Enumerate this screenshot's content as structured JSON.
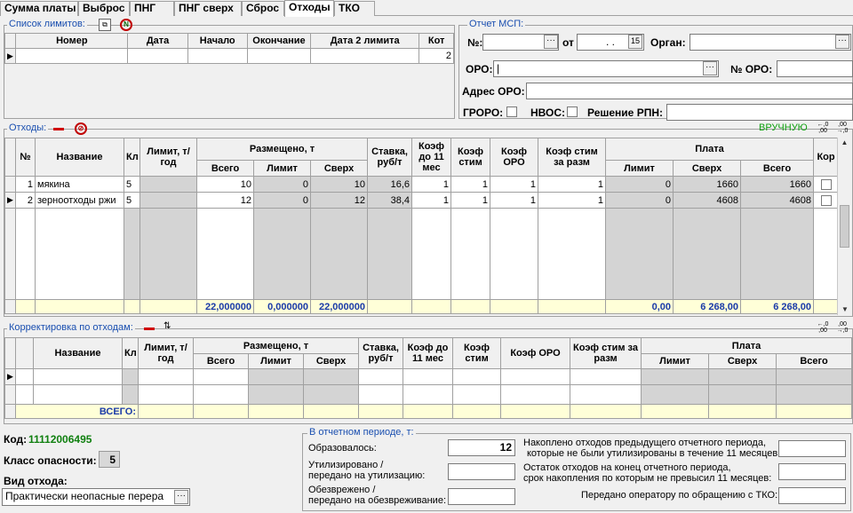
{
  "tabs": [
    "Сумма платы",
    "Выброс",
    "ПНГ",
    "ПНГ сверх",
    "Сброс",
    "Отходы",
    "ТКО"
  ],
  "limits": {
    "title": "Список лимитов:",
    "headers": [
      "Номер",
      "Дата",
      "Начало",
      "Окончание",
      "Дата 2 лимита",
      "Кот"
    ],
    "row": {
      "kot": "2"
    }
  },
  "report": {
    "title": "Отчет МСП:",
    "num_label": "№:",
    "from_label": "от",
    "date_value": ". .",
    "organ_label": "Орган:",
    "oro_label": "ОРО:",
    "oro_num_label": "№ ОРО:",
    "address_label": "Адрес ОРО:",
    "groro_label": "ГРОРО:",
    "nvos_label": "НВОС:",
    "rpn_label": "Решение РПН:"
  },
  "waste": {
    "title": "Отходы:",
    "mode": "ВРУЧНУЮ",
    "headers": {
      "n": "№",
      "name": "Название",
      "kl": "Кл",
      "limit": "Лимит, т/год",
      "placed": "Размещено, т",
      "total": "Всего",
      "lim": "Лимит",
      "over": "Сверх",
      "rate": "Ставка, руб/т",
      "k11": "Коэф до 11 мес",
      "kstim": "Коэф стим",
      "koro": "Коэф ОРО",
      "kstimr": "Коэф стим за разм",
      "pay": "Плата",
      "plim": "Лимит",
      "pover": "Сверх",
      "ptotal": "Всего",
      "kor": "Кор"
    },
    "rows": [
      {
        "n": "1",
        "name": "мякина",
        "kl": "5",
        "total": "10",
        "lim": "0",
        "over": "10",
        "rate": "16,6",
        "k11": "1",
        "kstim": "1",
        "koro": "1",
        "kstimr": "1",
        "plim": "0",
        "pover": "1660",
        "ptotal": "1660"
      },
      {
        "n": "2",
        "name": "зерноотходы ржи",
        "kl": "5",
        "total": "12",
        "lim": "0",
        "over": "12",
        "rate": "38,4",
        "k11": "1",
        "kstim": "1",
        "koro": "1",
        "kstimr": "1",
        "plim": "0",
        "pover": "4608",
        "ptotal": "4608"
      }
    ],
    "totals": {
      "total": "22,000000",
      "lim": "0,000000",
      "over": "22,000000",
      "plim": "0,00",
      "pover": "6 268,00",
      "ptotal": "6 268,00"
    }
  },
  "corr": {
    "title": "Корректировка по отходам:",
    "headers": {
      "name": "Название",
      "kl": "Кл",
      "limit": "Лимит, т/год",
      "placed": "Размещено, т",
      "total": "Всего",
      "lim": "Лимит",
      "over": "Сверх",
      "rate": "Ставка, руб/т",
      "k11": "Коэф до 11 мес",
      "kstim": "Коэф стим",
      "koro": "Коэф ОРО",
      "kstimr": "Коэф стим за разм",
      "pay": "Плата",
      "plim": "Лимит",
      "pover": "Сверх",
      "ptotal": "Всего"
    },
    "total_label": "ВСЕГО:"
  },
  "info": {
    "code_label": "Код:",
    "code_value": "11112006495",
    "class_label": "Класс опасности:",
    "class_value": "5",
    "kind_label": "Вид отхода:",
    "kind_value": "Практически неопасные перера"
  },
  "period": {
    "title": "В отчетном периоде, т:",
    "formed_label": "Образовалось:",
    "formed_value": "12",
    "utilized_label1": "Утилизировано /",
    "utilized_label2": "передано на утилизацию:",
    "neutral_label1": "Обезврежено /",
    "neutral_label2": "передано на обезвреживание:",
    "accum_label1": "Накоплено отходов предыдущего отчетного периода,",
    "accum_label2": "которые не были утилизированы в течение 11 месяцев:",
    "rest_label1": "Остаток отходов на конец отчетного периода,",
    "rest_label2": "срок накопления по которым не превысил 11 месяцев:",
    "tko_label": "Передано оператору по обращению с ТКО:"
  }
}
